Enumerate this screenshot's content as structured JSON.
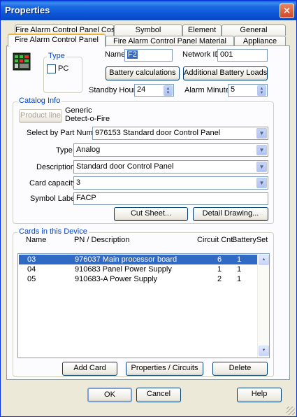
{
  "window": {
    "title": "Properties",
    "close_glyph": "✕"
  },
  "tabs": {
    "row1": [
      "Fire Alarm Control Panel Cost",
      "Symbol",
      "Element",
      "General"
    ],
    "row2": [
      "Fire Alarm Control Panel",
      "Fire Alarm Control Panel Material",
      "Appliance"
    ],
    "active": "Fire Alarm Control Panel"
  },
  "type_group": {
    "legend": "Type",
    "pc_label": "PC",
    "pc_checked": false
  },
  "header": {
    "name_label": "Name",
    "name_value": "F2",
    "network_label": "Network ID",
    "network_value": "001",
    "battery_calc_button": "Battery calculations",
    "additional_battery_button": "Additional Battery Loads",
    "standby_label": "Standby Hours",
    "standby_value": "24",
    "alarm_label": "Alarm Minutes",
    "alarm_value": "5"
  },
  "catalog": {
    "legend": "Catalog Info",
    "product_line_button": "Product line",
    "generic_text": "Generic",
    "brand_text": "Detect-o-Fire",
    "part_number_label": "Select by Part Number",
    "part_number_value": "976153 Standard door Control Panel",
    "type_label": "Type",
    "type_value": "Analog",
    "description_label": "Description",
    "description_value": "Standard door Control Panel",
    "card_capacity_label": "Card capacity",
    "card_capacity_value": "3",
    "symbol_label_label": "Symbol Label",
    "symbol_label_value": "FACP",
    "cut_sheet_button": "Cut Sheet...",
    "detail_drawing_button": "Detail Drawing..."
  },
  "cards": {
    "legend": "Cards in this Device",
    "columns": {
      "name": "Name",
      "pn": "PN / Description",
      "circuit": "Circuit Cnt",
      "battery": "BatterySet"
    },
    "rows": [
      {
        "name": "03",
        "pn": "976037 Main processor board",
        "circuit": "6",
        "battery": "1",
        "selected": true
      },
      {
        "name": "04",
        "pn": "910683 Panel Power Supply",
        "circuit": "1",
        "battery": "1",
        "selected": false
      },
      {
        "name": "05",
        "pn": "910683-A Power Supply",
        "circuit": "2",
        "battery": "1",
        "selected": false
      }
    ],
    "add_button": "Add Card",
    "properties_button": "Properties / Circuits",
    "delete_button": "Delete"
  },
  "footer": {
    "ok": "OK",
    "cancel": "Cancel",
    "help": "Help"
  },
  "colors": {
    "title_bar": "#0b55d5",
    "selection": "#316ac5",
    "legend_text": "#0046d5",
    "tab_highlight": "#f0b436"
  }
}
